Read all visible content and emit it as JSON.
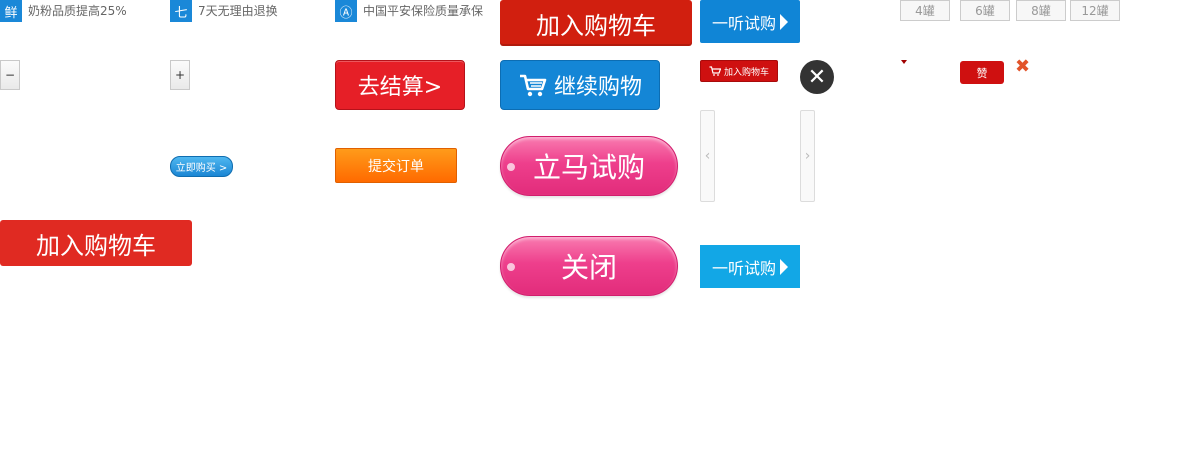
{
  "features": [
    {
      "icon": "fresh-icon",
      "icon_glyph": "鲜",
      "text": "奶粉品质提高25%"
    },
    {
      "icon": "return-icon",
      "icon_glyph": "七",
      "text": "7天无理由退换"
    },
    {
      "icon": "insurance-icon",
      "icon_glyph": "Ⓐ",
      "text": "中国平安保险质量承保"
    }
  ],
  "stepper": {
    "minus": "−",
    "plus": "+"
  },
  "buttons": {
    "add_to_cart_top": "加入购物车",
    "add_to_cart_bottom": "加入购物车",
    "trial_can_top": "一听试购",
    "trial_can_bottom": "一听试购",
    "checkout": "去结算>",
    "continue_shopping": "继续购物",
    "buy_now": "立即购买 >",
    "submit_order": "提交订单",
    "try_now": "立马试购",
    "close": "关闭",
    "mini_add_to_cart": "加入购物车",
    "like": "赞"
  },
  "icons": {
    "close_glyph": "✕",
    "remove_glyph": "✖",
    "prev_glyph": "‹",
    "next_glyph": "›",
    "cart_glyph": "🛒"
  },
  "can_options": [
    "4罐",
    "6罐",
    "8罐",
    "12罐"
  ],
  "colors": {
    "brand_red": "#d11f0f",
    "brand_blue": "#1085d6",
    "brand_pink": "#ee3f8c",
    "brand_orange": "#ff7a00"
  }
}
